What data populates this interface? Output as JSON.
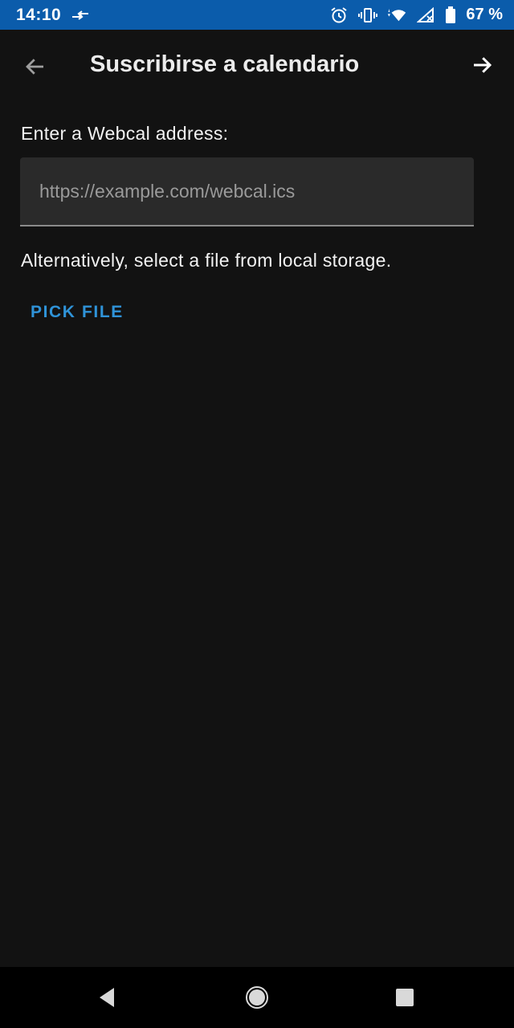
{
  "status_bar": {
    "time": "14:10",
    "battery_percent": "67 %",
    "background_color": "#0b5cab",
    "icons": [
      "data-transfer-icon",
      "alarm-icon",
      "vibrate-icon",
      "wifi-icon",
      "signal-icon",
      "battery-icon"
    ]
  },
  "app_bar": {
    "title": "Suscribirse a calendario",
    "back_icon": "arrow-back-icon",
    "forward_icon": "arrow-forward-icon"
  },
  "form": {
    "webcal_label": "Enter a Webcal address:",
    "webcal_value": "",
    "webcal_placeholder": "https://example.com/webcal.ics",
    "alternative_text": "Alternatively, select a file from local storage.",
    "pick_file_label": "PICK FILE"
  },
  "nav_bar": {
    "buttons": [
      "back-triangle-icon",
      "home-circle-icon",
      "recents-square-icon"
    ]
  },
  "colors": {
    "background": "#121212",
    "accent": "#2f93d8",
    "field_background": "#2a2a2a"
  }
}
